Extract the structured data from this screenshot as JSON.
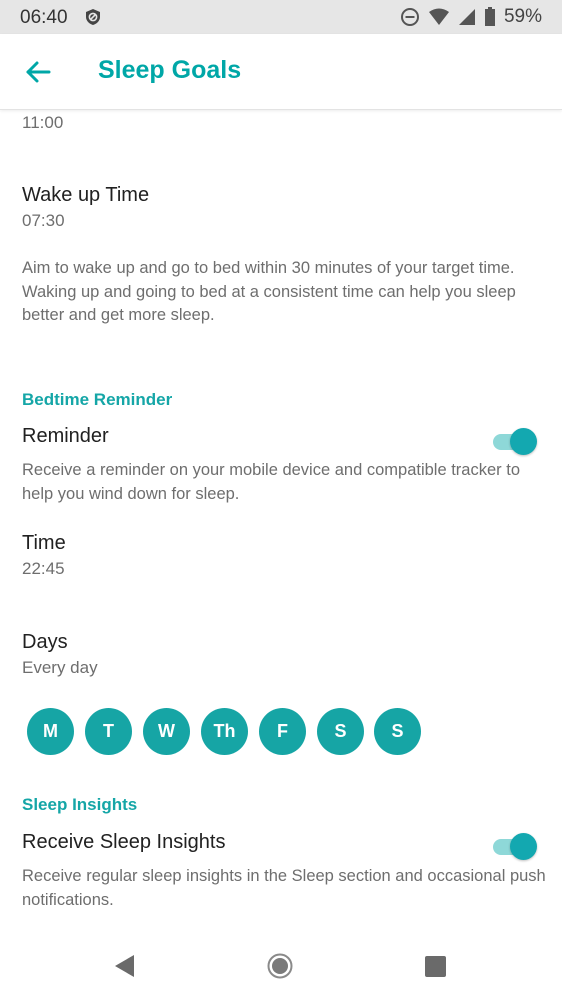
{
  "status_bar": {
    "time": "06:40",
    "battery": "59%",
    "icons": [
      "privacy-icon",
      "do-not-disturb-icon",
      "wifi-icon",
      "signal-icon",
      "battery-icon"
    ]
  },
  "app_bar": {
    "title": "Sleep Goals",
    "back_icon": "arrow-left-icon",
    "accent_color": "#00a7a7"
  },
  "sleep_schedule": {
    "bedtime_value": "11:00",
    "wake_label": "Wake up Time",
    "wake_value": "07:30",
    "description": "Aim to wake up and go to bed within 30 minutes of your target time. Waking up and going to bed at a consistent time can help you sleep better and get more sleep."
  },
  "bedtime_reminder": {
    "section_title": "Bedtime Reminder",
    "reminder_label": "Reminder",
    "reminder_on": true,
    "reminder_description": "Receive a reminder on your mobile device and compatible tracker to help you wind down for sleep.",
    "time_label": "Time",
    "time_value": "22:45",
    "days_label": "Days",
    "days_value": "Every day",
    "days": [
      "M",
      "T",
      "W",
      "Th",
      "F",
      "S",
      "S"
    ]
  },
  "sleep_insights": {
    "section_title": "Sleep Insights",
    "label": "Receive Sleep Insights",
    "enabled": true,
    "description": "Receive regular sleep insights in the Sleep section and occasional push notifications."
  },
  "nav_bar": {
    "icons": [
      "back-triangle-icon",
      "home-circle-icon",
      "recents-square-icon"
    ]
  }
}
